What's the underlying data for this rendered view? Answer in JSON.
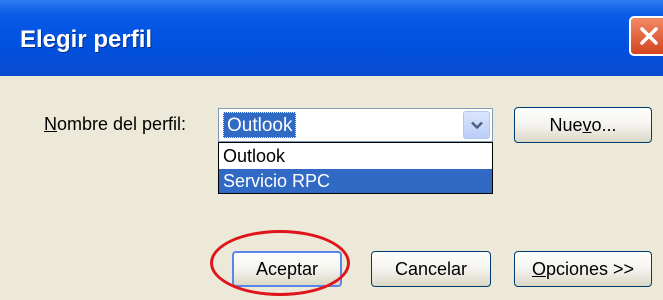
{
  "window": {
    "title": "Elegir perfil",
    "close_icon": "close-icon",
    "colors": {
      "titlebar": "#0052e0",
      "client": "#ece9d8",
      "selection": "#316ac5",
      "highlight_ring": "#e0141b"
    }
  },
  "profile": {
    "label_pre": "N",
    "label_rest": "ombre del perfil:",
    "selected_value": "Outlook",
    "dropdown_icon": "chevron-down-icon",
    "options": [
      "Outlook",
      "Servicio RPC"
    ],
    "highlighted_option": "Servicio RPC"
  },
  "buttons": {
    "nuevo_a": "Nue",
    "nuevo_mn": "v",
    "nuevo_b": "o...",
    "aceptar": "Aceptar",
    "cancelar": "Cancelar",
    "opciones_mn": "O",
    "opciones_rest": "pciones >>"
  }
}
